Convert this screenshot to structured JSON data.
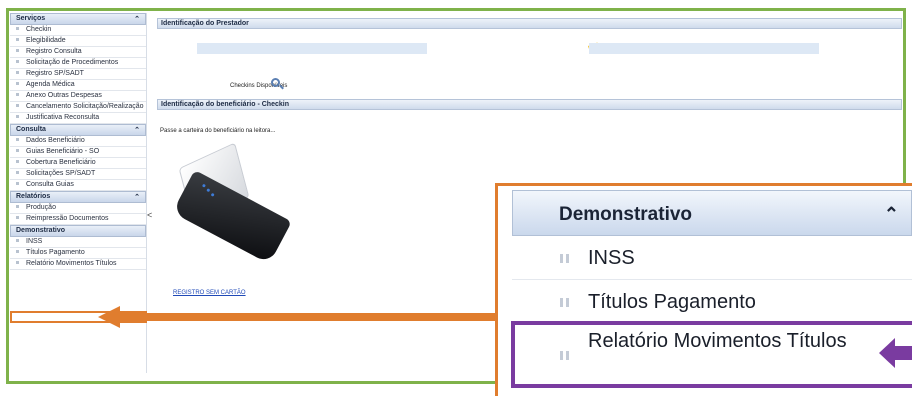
{
  "sidebar": {
    "sections": [
      {
        "title": "Serviços",
        "items": [
          "Checkin",
          "Elegibilidade",
          "Registro Consulta",
          "Solicitação de Procedimentos",
          "Registro SP/SADT",
          "Agenda Médica",
          "Anexo Outras Despesas",
          "Cancelamento Solicitação/Realização",
          "Justificativa Reconsulta"
        ]
      },
      {
        "title": "Consulta",
        "items": [
          "Dados Beneficiário",
          "Guias Beneficiário - SO",
          "Cobertura Beneficiário",
          "Solicitações SP/SADT",
          "Consulta Guias"
        ]
      },
      {
        "title": "Relatórios",
        "items": [
          "Produção",
          "Reimpressão Documentos"
        ]
      },
      {
        "title": "Demonstrativo",
        "items": [
          "INSS",
          "Títulos Pagamento",
          "Relatório Movimentos Títulos"
        ]
      }
    ]
  },
  "main": {
    "prestador_title": "Identificação do Prestador",
    "checkins_label": "Checkins Disponíveis",
    "beneficiario_title": "Identificação do beneficiário - Checkin",
    "hint": "Passe a carteira do beneficiário na leitora...",
    "link": "REGISTRO SEM CARTÃO"
  },
  "zoom": {
    "title": "Demonstrativo",
    "items": [
      "INSS",
      "Títulos Pagamento",
      "Relatório Movimentos Títulos"
    ]
  },
  "colors": {
    "frame": "#7fb24a",
    "highlight_orange": "#e07d2e",
    "highlight_purple": "#7a3ba0"
  }
}
